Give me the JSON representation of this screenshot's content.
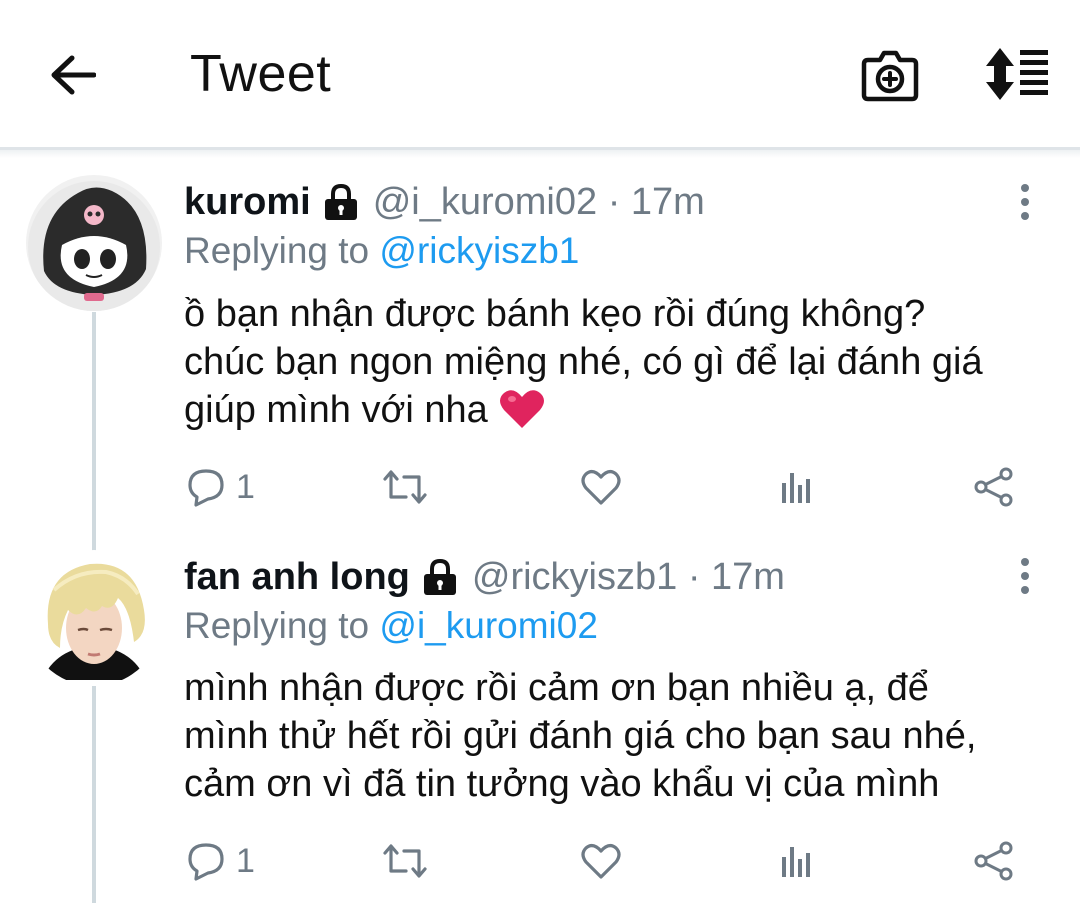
{
  "header": {
    "title": "Tweet",
    "back_icon": "arrow-left-icon",
    "camera_icon": "camera-add-icon",
    "sort_icon": "sort-icon"
  },
  "tweets": [
    {
      "name": "kuromi",
      "handle": "@i_kuromi02 · 17m",
      "replying_prefix": "Replying to ",
      "replying_to": "@rickyiszb1",
      "body_lines": [
        "ồ bạn nhận được bánh kẹo rồi đúng không?",
        "chúc bạn ngon miệng nhé, có gì để lại đánh giá",
        "giúp mình với nha"
      ],
      "emoji": "❤️",
      "reply_count": "1"
    },
    {
      "name": "fan anh long",
      "handle": "@rickyiszb1 · 17m",
      "replying_prefix": "Replying to ",
      "replying_to": "@i_kuromi02",
      "body_lines": [
        "mình nhận được rồi cảm ơn bạn nhiều ạ, để",
        "mình thử hết rồi gửi đánh giá cho bạn sau nhé,",
        "cảm ơn vì đã tin tưởng vào khẩu vị của mình"
      ],
      "reply_count": "1"
    }
  ],
  "colors": {
    "accent": "#1d9bf0",
    "secondary_text": "#6e7a85",
    "icon": "#6e7a85",
    "heart": "#e0245e"
  }
}
